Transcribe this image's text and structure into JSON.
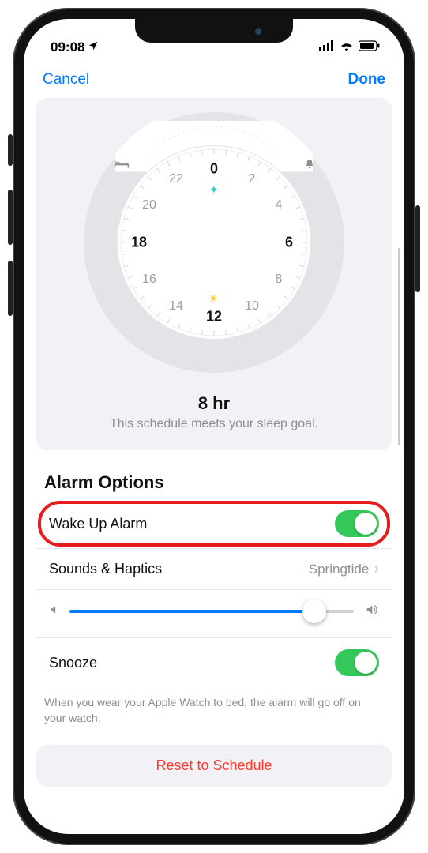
{
  "status": {
    "time": "09:08"
  },
  "nav": {
    "cancel": "Cancel",
    "done": "Done"
  },
  "dial": {
    "duration": "8 hr",
    "goal_msg": "This schedule meets your sleep goal.",
    "hours": [
      "0",
      "2",
      "4",
      "6",
      "8",
      "10",
      "12",
      "14",
      "16",
      "18",
      "20",
      "22"
    ],
    "bold_hours": [
      "0",
      "6",
      "12",
      "18"
    ]
  },
  "section": {
    "alarm_options": "Alarm Options"
  },
  "rows": {
    "wake_up": "Wake Up Alarm",
    "sounds": "Sounds & Haptics",
    "sounds_value": "Springtide",
    "snooze": "Snooze"
  },
  "hint": "When you wear your Apple Watch to bed, the alarm will go off on your watch.",
  "reset": "Reset to Schedule",
  "slider": {
    "value_pct": 86
  },
  "icons": {
    "bed": "bed",
    "bell": "bell",
    "sparkle": "✦",
    "sun": "☀"
  }
}
